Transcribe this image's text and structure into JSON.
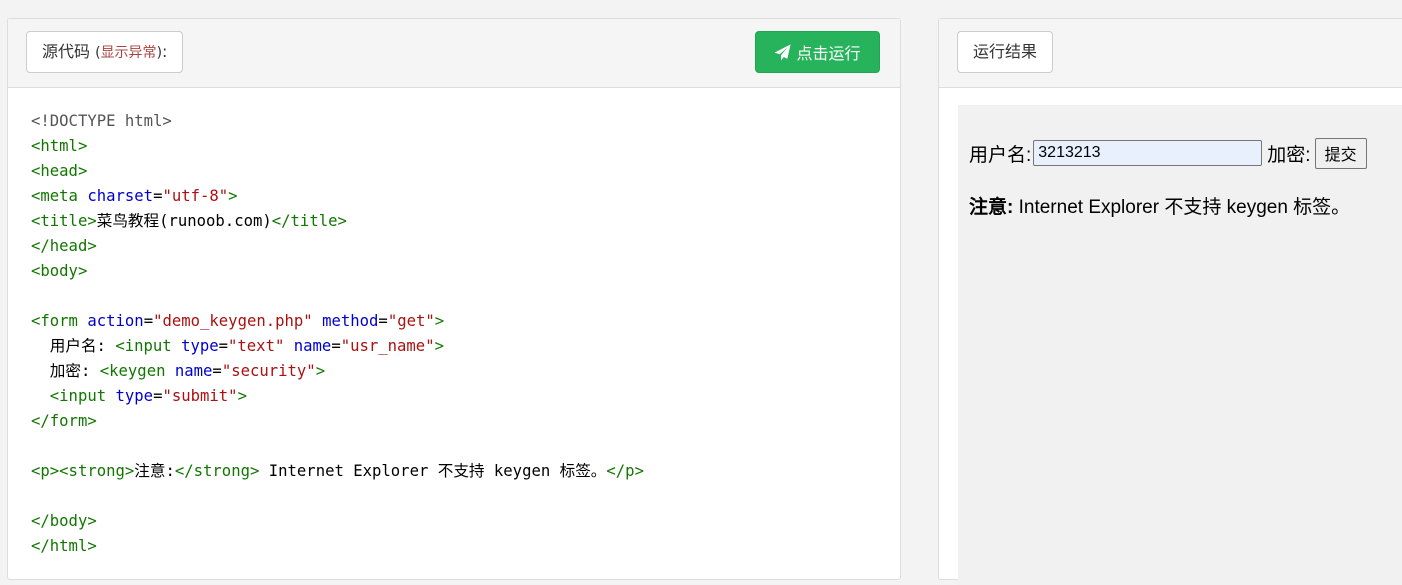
{
  "editor": {
    "label_main": "源代码 ",
    "label_paren_open": "(",
    "label_warning": "显示异常",
    "label_paren_close": ")",
    "label_colon": ":",
    "run_button": "点击运行"
  },
  "code": {
    "lines": [
      [
        [
          "doc",
          "<!DOCTYPE html>"
        ]
      ],
      [
        [
          "tag",
          "<html>"
        ]
      ],
      [
        [
          "tag",
          "<head>"
        ]
      ],
      [
        [
          "tag",
          "<meta "
        ],
        [
          "attr",
          "charset"
        ],
        [
          "txt",
          "="
        ],
        [
          "val",
          "\"utf-8\""
        ],
        [
          "tag",
          ">"
        ]
      ],
      [
        [
          "tag",
          "<title>"
        ],
        [
          "txt",
          "菜鸟教程(runoob.com)"
        ],
        [
          "tag",
          "</title>"
        ]
      ],
      [
        [
          "tag",
          "</head>"
        ]
      ],
      [
        [
          "tag",
          "<body>"
        ]
      ],
      [],
      [
        [
          "tag",
          "<form "
        ],
        [
          "attr",
          "action"
        ],
        [
          "txt",
          "="
        ],
        [
          "val",
          "\"demo_keygen.php\""
        ],
        [
          "txt",
          " "
        ],
        [
          "attr",
          "method"
        ],
        [
          "txt",
          "="
        ],
        [
          "val",
          "\"get\""
        ],
        [
          "tag",
          ">"
        ]
      ],
      [
        [
          "txt",
          "  用户名: "
        ],
        [
          "tag",
          "<input "
        ],
        [
          "attr",
          "type"
        ],
        [
          "txt",
          "="
        ],
        [
          "val",
          "\"text\""
        ],
        [
          "txt",
          " "
        ],
        [
          "attr",
          "name"
        ],
        [
          "txt",
          "="
        ],
        [
          "val",
          "\"usr_name\""
        ],
        [
          "tag",
          ">"
        ]
      ],
      [
        [
          "txt",
          "  加密: "
        ],
        [
          "tag",
          "<keygen "
        ],
        [
          "attr",
          "name"
        ],
        [
          "txt",
          "="
        ],
        [
          "val",
          "\"security\""
        ],
        [
          "tag",
          ">"
        ]
      ],
      [
        [
          "txt",
          "  "
        ],
        [
          "tag",
          "<input "
        ],
        [
          "attr",
          "type"
        ],
        [
          "txt",
          "="
        ],
        [
          "val",
          "\"submit\""
        ],
        [
          "tag",
          ">"
        ]
      ],
      [
        [
          "tag",
          "</form>"
        ]
      ],
      [],
      [
        [
          "tag",
          "<p><strong>"
        ],
        [
          "txt",
          "注意:"
        ],
        [
          "tag",
          "</strong>"
        ],
        [
          "txt",
          " Internet Explorer 不支持 keygen 标签。"
        ],
        [
          "tag",
          "</p>"
        ]
      ],
      [],
      [
        [
          "tag",
          "</body>"
        ]
      ],
      [
        [
          "tag",
          "</html>"
        ]
      ]
    ]
  },
  "result": {
    "label": "运行结果",
    "username_label": "用户名:",
    "username_value": "3213213",
    "keygen_label": "加密:",
    "submit_label": "提交",
    "note_strong": "注意:",
    "note_text": " Internet Explorer 不支持 keygen 标签。"
  },
  "colors": {
    "run_button": "#27b35b",
    "tag": "#117700",
    "attr": "#0000cc",
    "value": "#aa1111",
    "warning": "#a94442"
  },
  "icons": {
    "run_button_icon": "paper-plane-icon"
  }
}
